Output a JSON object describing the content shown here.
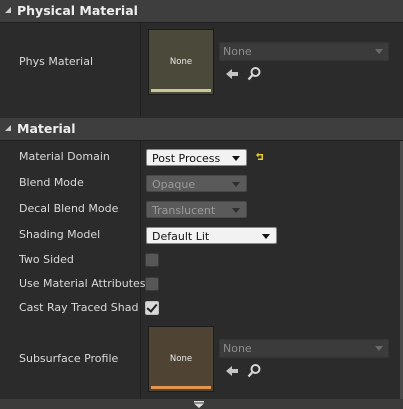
{
  "physical_material_section": {
    "title": "Physical Material",
    "phys_material": {
      "label": "Phys Material",
      "thumbnail_text": "None",
      "asset_value": "None",
      "thumb_color": "#4b4a3a",
      "bar_color": "#c8c89a"
    }
  },
  "material_section": {
    "title": "Material",
    "properties": {
      "material_domain": {
        "label": "Material Domain",
        "value": "Post Process"
      },
      "blend_mode": {
        "label": "Blend Mode",
        "value": "Opaque"
      },
      "decal_blend_mode": {
        "label": "Decal Blend Mode",
        "value": "Translucent"
      },
      "shading_model": {
        "label": "Shading Model",
        "value": "Default Lit"
      },
      "two_sided": {
        "label": "Two Sided",
        "checked": false
      },
      "use_material_attributes": {
        "label": "Use Material Attributes",
        "checked": false
      },
      "cast_ray_traced_shadows": {
        "label": "Cast Ray Traced Shadows",
        "checked": true
      }
    },
    "subsurface_profile": {
      "label": "Subsurface Profile",
      "thumbnail_text": "None",
      "asset_value": "None",
      "thumb_color": "#4f4334",
      "bar_color": "#e3954f"
    }
  },
  "icons": {
    "reset_to_default": "reset-arrow-icon",
    "use_selected": "left-arrow-icon",
    "browse": "magnifier-icon",
    "more": "chevron-down-icon"
  },
  "colors": {
    "panel_bg": "#2b2b2b",
    "header_bg": "#3e3e3e",
    "reset_icon": "#e6cc2e"
  }
}
